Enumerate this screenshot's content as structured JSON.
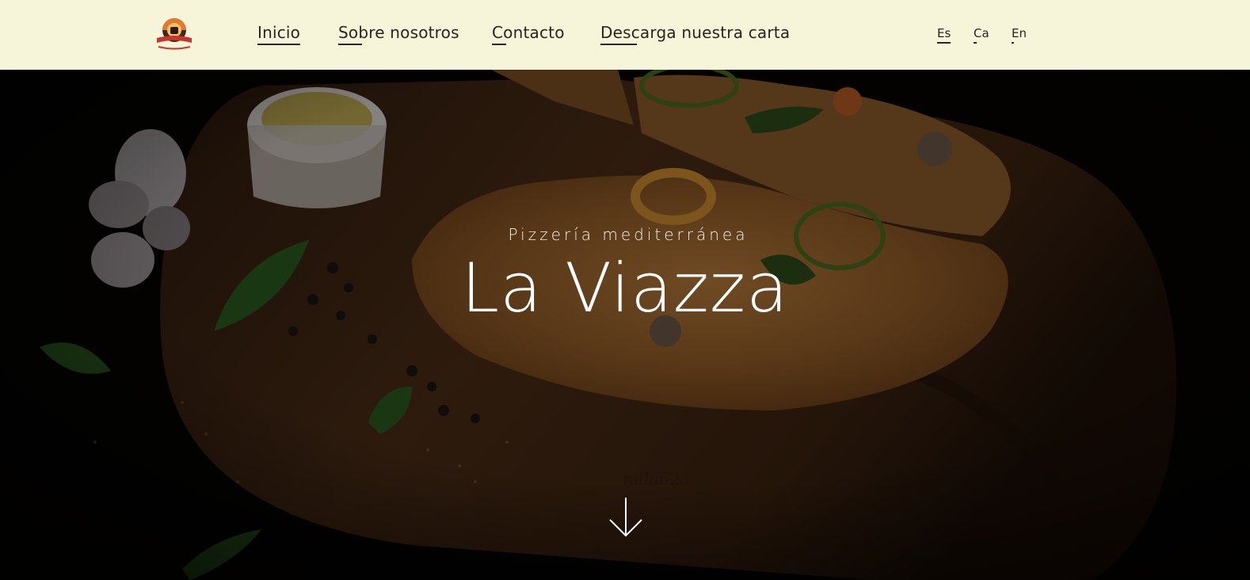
{
  "header": {
    "logo_icon": "pizzeria-logo-icon",
    "nav": {
      "inicio": "Inicio",
      "sobre": "Sobre nosotros",
      "contacto": "Contacto",
      "carta": "Descarga nuestra carta"
    },
    "languages": {
      "es": "Es",
      "ca": "Ca",
      "en": "En"
    }
  },
  "hero": {
    "subtitle": "Pizzería mediterránea",
    "title": "La Viazza",
    "watermark": "mila623",
    "scroll_icon": "arrow-down-icon"
  },
  "colors": {
    "header_bg": "#f6f4d9",
    "nav_text": "#2a2420",
    "hero_text": "#ffffff"
  }
}
